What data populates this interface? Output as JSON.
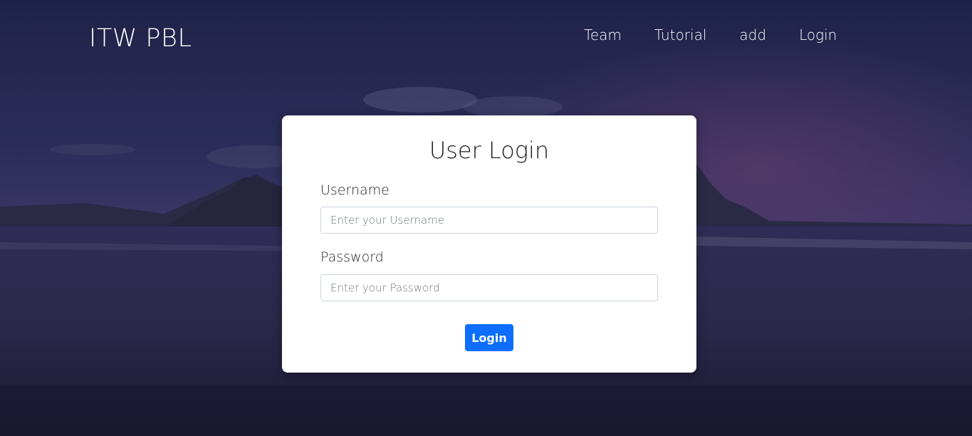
{
  "header": {
    "brand": "ITW PBL",
    "nav": [
      {
        "label": "Team"
      },
      {
        "label": "Tutorial"
      },
      {
        "label": "add"
      },
      {
        "label": "Login"
      }
    ]
  },
  "login_card": {
    "title": "User Login",
    "username_label": "Username",
    "username_placeholder": "Enter your Username",
    "username_value": "",
    "password_label": "Password",
    "password_placeholder": "Enter your Password",
    "password_value": "",
    "submit_label": "Login"
  },
  "colors": {
    "background": "#23244a",
    "card": "#ffffff",
    "primary_button": "#0d6efd",
    "nav_text": "#ffffff"
  }
}
